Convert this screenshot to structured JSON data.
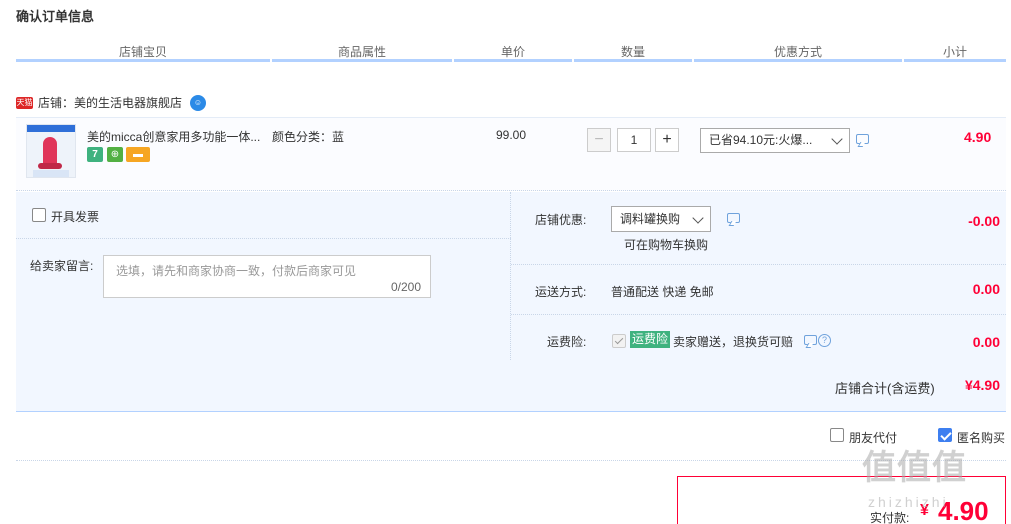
{
  "title": "确认订单信息",
  "table_headers": [
    "店铺宝贝",
    "商品属性",
    "单价",
    "数量",
    "优惠方式",
    "小计"
  ],
  "shop": {
    "badge": "天猫",
    "label": "店铺：美的生活电器旗舰店"
  },
  "item": {
    "title": "美的micca创意家用多功能一体...",
    "attr": "颜色分类：蓝",
    "badges": [
      "7",
      "",
      ""
    ],
    "price": "99.00",
    "quantity": "1",
    "minus": "−",
    "plus": "+",
    "promo": "已省94.10元:火爆...",
    "subtotal": "4.90"
  },
  "invoice": {
    "label": "开具发票"
  },
  "message": {
    "label": "给卖家留言:",
    "placeholder": "选填，请先和商家协商一致，付款后商家可见",
    "count": "0/200"
  },
  "shop_discount": {
    "label": "店铺优惠:",
    "select": "调料罐换购",
    "note": "可在购物车换购",
    "amount": "-0.00"
  },
  "shipping": {
    "label": "运送方式:",
    "value": "普通配送 快递 免邮",
    "amount": "0.00"
  },
  "insurance": {
    "label": "运费险:",
    "tag": "运费险",
    "text": "卖家赠送，退换货可赔",
    "help": "?",
    "amount": "0.00"
  },
  "shop_total": {
    "label": "店铺合计(含运费)",
    "amount": "¥4.90"
  },
  "options": {
    "friend_pay": "朋友代付",
    "anonymous": "匿名购买"
  },
  "payment": {
    "label": "实付款:",
    "currency": "¥",
    "amount": "4.90"
  },
  "watermark": {
    "main": "值值值",
    "sub": "zhizhizhi"
  },
  "colors": {
    "accent_red": "#ff0036",
    "panel_blue": "#f2f7ff",
    "header_line": "#b2d1ff",
    "checkbox_blue": "#3e7ff0",
    "green_tag": "#3fb27f"
  }
}
